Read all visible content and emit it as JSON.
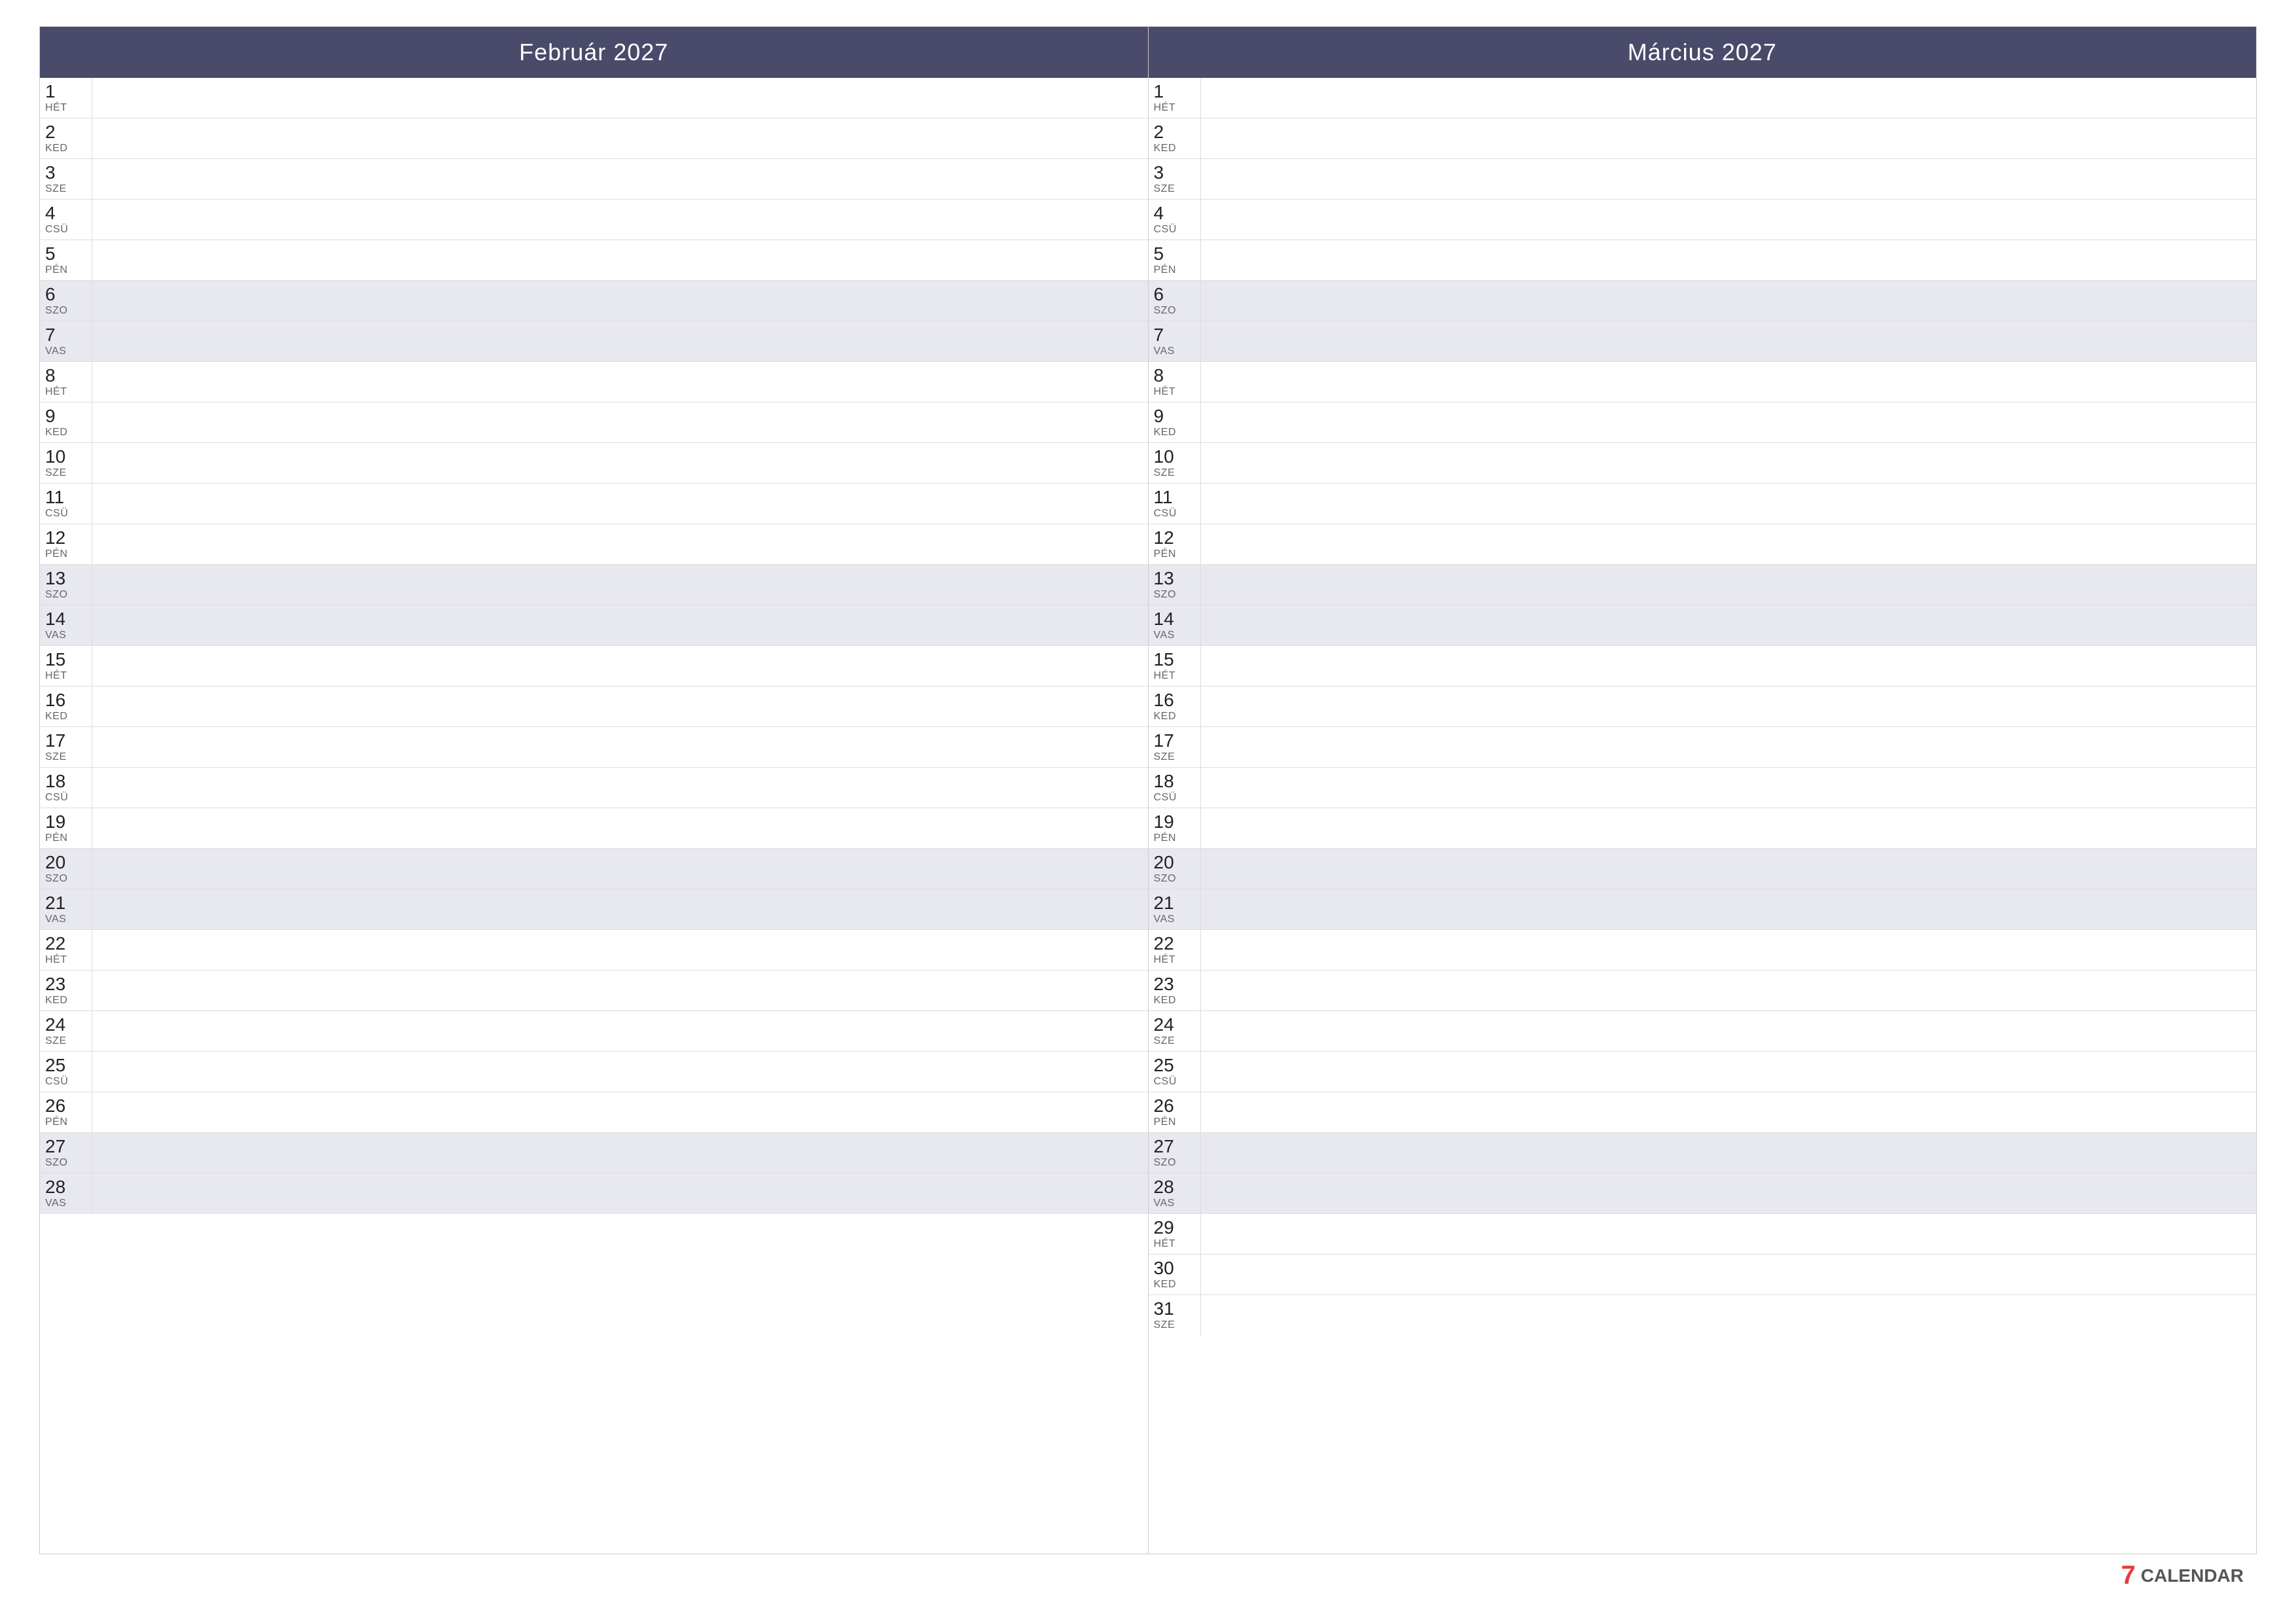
{
  "page": {
    "background": "#ffffff"
  },
  "watermark": {
    "number": "7",
    "label": "CALENDAR"
  },
  "february": {
    "title": "Február 2027",
    "days": [
      {
        "num": "1",
        "name": "HÉT",
        "weekend": false
      },
      {
        "num": "2",
        "name": "KED",
        "weekend": false
      },
      {
        "num": "3",
        "name": "SZE",
        "weekend": false
      },
      {
        "num": "4",
        "name": "CSÜ",
        "weekend": false
      },
      {
        "num": "5",
        "name": "PÉN",
        "weekend": false
      },
      {
        "num": "6",
        "name": "SZO",
        "weekend": true
      },
      {
        "num": "7",
        "name": "VAS",
        "weekend": true
      },
      {
        "num": "8",
        "name": "HÉT",
        "weekend": false
      },
      {
        "num": "9",
        "name": "KED",
        "weekend": false
      },
      {
        "num": "10",
        "name": "SZE",
        "weekend": false
      },
      {
        "num": "11",
        "name": "CSÜ",
        "weekend": false
      },
      {
        "num": "12",
        "name": "PÉN",
        "weekend": false
      },
      {
        "num": "13",
        "name": "SZO",
        "weekend": true
      },
      {
        "num": "14",
        "name": "VAS",
        "weekend": true
      },
      {
        "num": "15",
        "name": "HÉT",
        "weekend": false
      },
      {
        "num": "16",
        "name": "KED",
        "weekend": false
      },
      {
        "num": "17",
        "name": "SZE",
        "weekend": false
      },
      {
        "num": "18",
        "name": "CSÜ",
        "weekend": false
      },
      {
        "num": "19",
        "name": "PÉN",
        "weekend": false
      },
      {
        "num": "20",
        "name": "SZO",
        "weekend": true
      },
      {
        "num": "21",
        "name": "VAS",
        "weekend": true
      },
      {
        "num": "22",
        "name": "HÉT",
        "weekend": false
      },
      {
        "num": "23",
        "name": "KED",
        "weekend": false
      },
      {
        "num": "24",
        "name": "SZE",
        "weekend": false
      },
      {
        "num": "25",
        "name": "CSÜ",
        "weekend": false
      },
      {
        "num": "26",
        "name": "PÉN",
        "weekend": false
      },
      {
        "num": "27",
        "name": "SZO",
        "weekend": true
      },
      {
        "num": "28",
        "name": "VAS",
        "weekend": true
      }
    ]
  },
  "march": {
    "title": "Március 2027",
    "days": [
      {
        "num": "1",
        "name": "HÉT",
        "weekend": false
      },
      {
        "num": "2",
        "name": "KED",
        "weekend": false
      },
      {
        "num": "3",
        "name": "SZE",
        "weekend": false
      },
      {
        "num": "4",
        "name": "CSÜ",
        "weekend": false
      },
      {
        "num": "5",
        "name": "PÉN",
        "weekend": false
      },
      {
        "num": "6",
        "name": "SZO",
        "weekend": true
      },
      {
        "num": "7",
        "name": "VAS",
        "weekend": true
      },
      {
        "num": "8",
        "name": "HÉT",
        "weekend": false
      },
      {
        "num": "9",
        "name": "KED",
        "weekend": false
      },
      {
        "num": "10",
        "name": "SZE",
        "weekend": false
      },
      {
        "num": "11",
        "name": "CSÜ",
        "weekend": false
      },
      {
        "num": "12",
        "name": "PÉN",
        "weekend": false
      },
      {
        "num": "13",
        "name": "SZO",
        "weekend": true
      },
      {
        "num": "14",
        "name": "VAS",
        "weekend": true
      },
      {
        "num": "15",
        "name": "HÉT",
        "weekend": false
      },
      {
        "num": "16",
        "name": "KED",
        "weekend": false
      },
      {
        "num": "17",
        "name": "SZE",
        "weekend": false
      },
      {
        "num": "18",
        "name": "CSÜ",
        "weekend": false
      },
      {
        "num": "19",
        "name": "PÉN",
        "weekend": false
      },
      {
        "num": "20",
        "name": "SZO",
        "weekend": true
      },
      {
        "num": "21",
        "name": "VAS",
        "weekend": true
      },
      {
        "num": "22",
        "name": "HÉT",
        "weekend": false
      },
      {
        "num": "23",
        "name": "KED",
        "weekend": false
      },
      {
        "num": "24",
        "name": "SZE",
        "weekend": false
      },
      {
        "num": "25",
        "name": "CSÜ",
        "weekend": false
      },
      {
        "num": "26",
        "name": "PÉN",
        "weekend": false
      },
      {
        "num": "27",
        "name": "SZO",
        "weekend": true
      },
      {
        "num": "28",
        "name": "VAS",
        "weekend": true
      },
      {
        "num": "29",
        "name": "HÉT",
        "weekend": false
      },
      {
        "num": "30",
        "name": "KED",
        "weekend": false
      },
      {
        "num": "31",
        "name": "SZE",
        "weekend": false
      }
    ]
  }
}
